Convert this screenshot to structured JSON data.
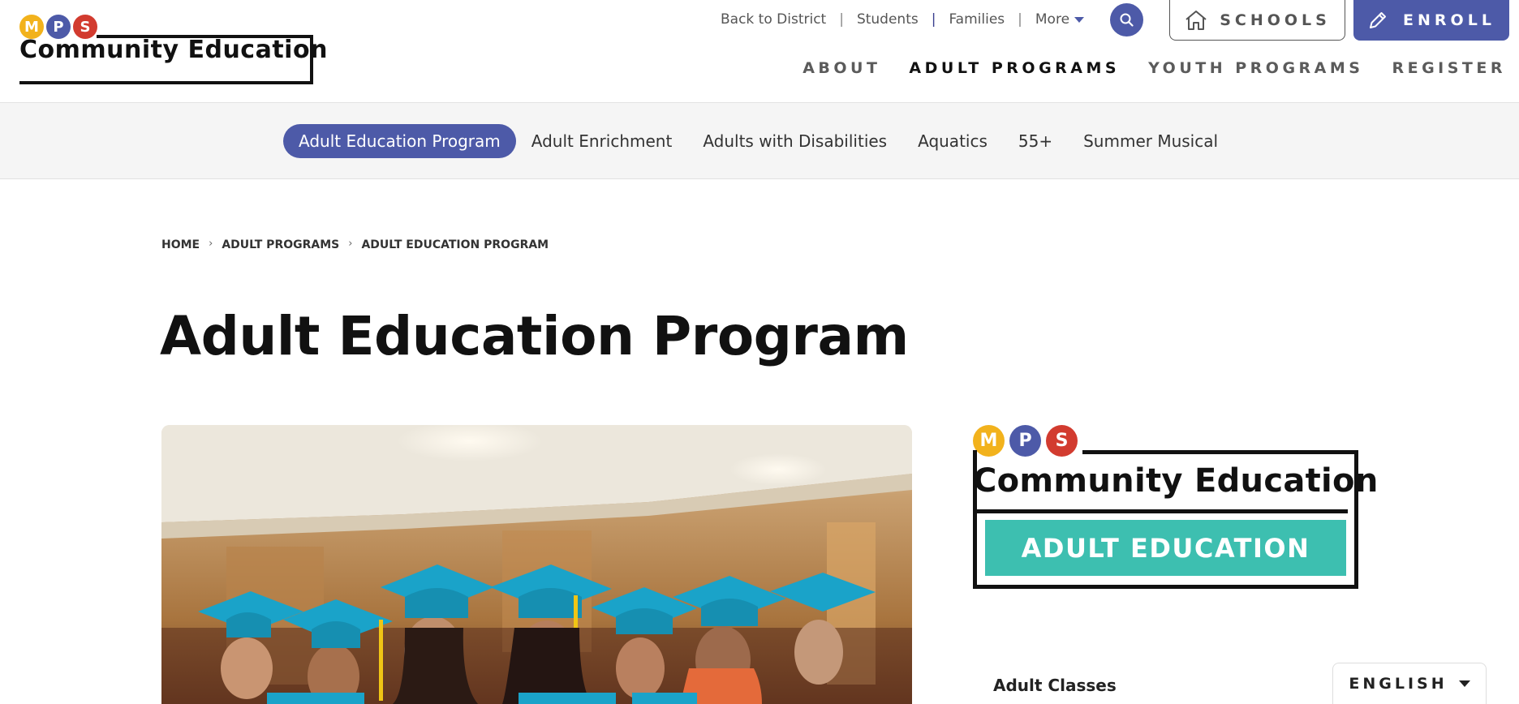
{
  "logo": {
    "letters": [
      "M",
      "P",
      "S"
    ],
    "name": "Community Education"
  },
  "utility_nav": {
    "items": [
      "Back to District",
      "Students",
      "Families"
    ],
    "more_label": "More"
  },
  "search": {
    "icon": "search-icon"
  },
  "schools_button": {
    "label": "SCHOOLS",
    "icon": "house-icon"
  },
  "enroll_button": {
    "label": "ENROLL",
    "icon": "pencil-icon"
  },
  "main_nav": {
    "items": [
      {
        "label": "ABOUT",
        "active": false
      },
      {
        "label": "ADULT PROGRAMS",
        "active": true
      },
      {
        "label": "YOUTH PROGRAMS",
        "active": false
      },
      {
        "label": "REGISTER",
        "active": false
      }
    ]
  },
  "sub_nav": {
    "items": [
      {
        "label": "Adult Education Program",
        "active": true
      },
      {
        "label": "Adult Enrichment",
        "active": false
      },
      {
        "label": "Adults with Disabilities",
        "active": false
      },
      {
        "label": "Aquatics",
        "active": false
      },
      {
        "label": "55+",
        "active": false
      },
      {
        "label": "Summer Musical",
        "active": false
      }
    ]
  },
  "breadcrumb": [
    "HOME",
    "ADULT PROGRAMS",
    "ADULT EDUCATION PROGRAM"
  ],
  "page_title": "Adult Education Program",
  "side_logo": {
    "letters": [
      "M",
      "P",
      "S"
    ],
    "name": "Community Education",
    "banner": "ADULT EDUCATION"
  },
  "sidebar": {
    "adult_classes": "Adult Classes"
  },
  "language": {
    "label": "ENGLISH"
  },
  "colors": {
    "brand_purple": "#4d5aa8",
    "teal": "#3dbfb0",
    "logo_yellow": "#f2b21c",
    "logo_red": "#d23b2f"
  }
}
